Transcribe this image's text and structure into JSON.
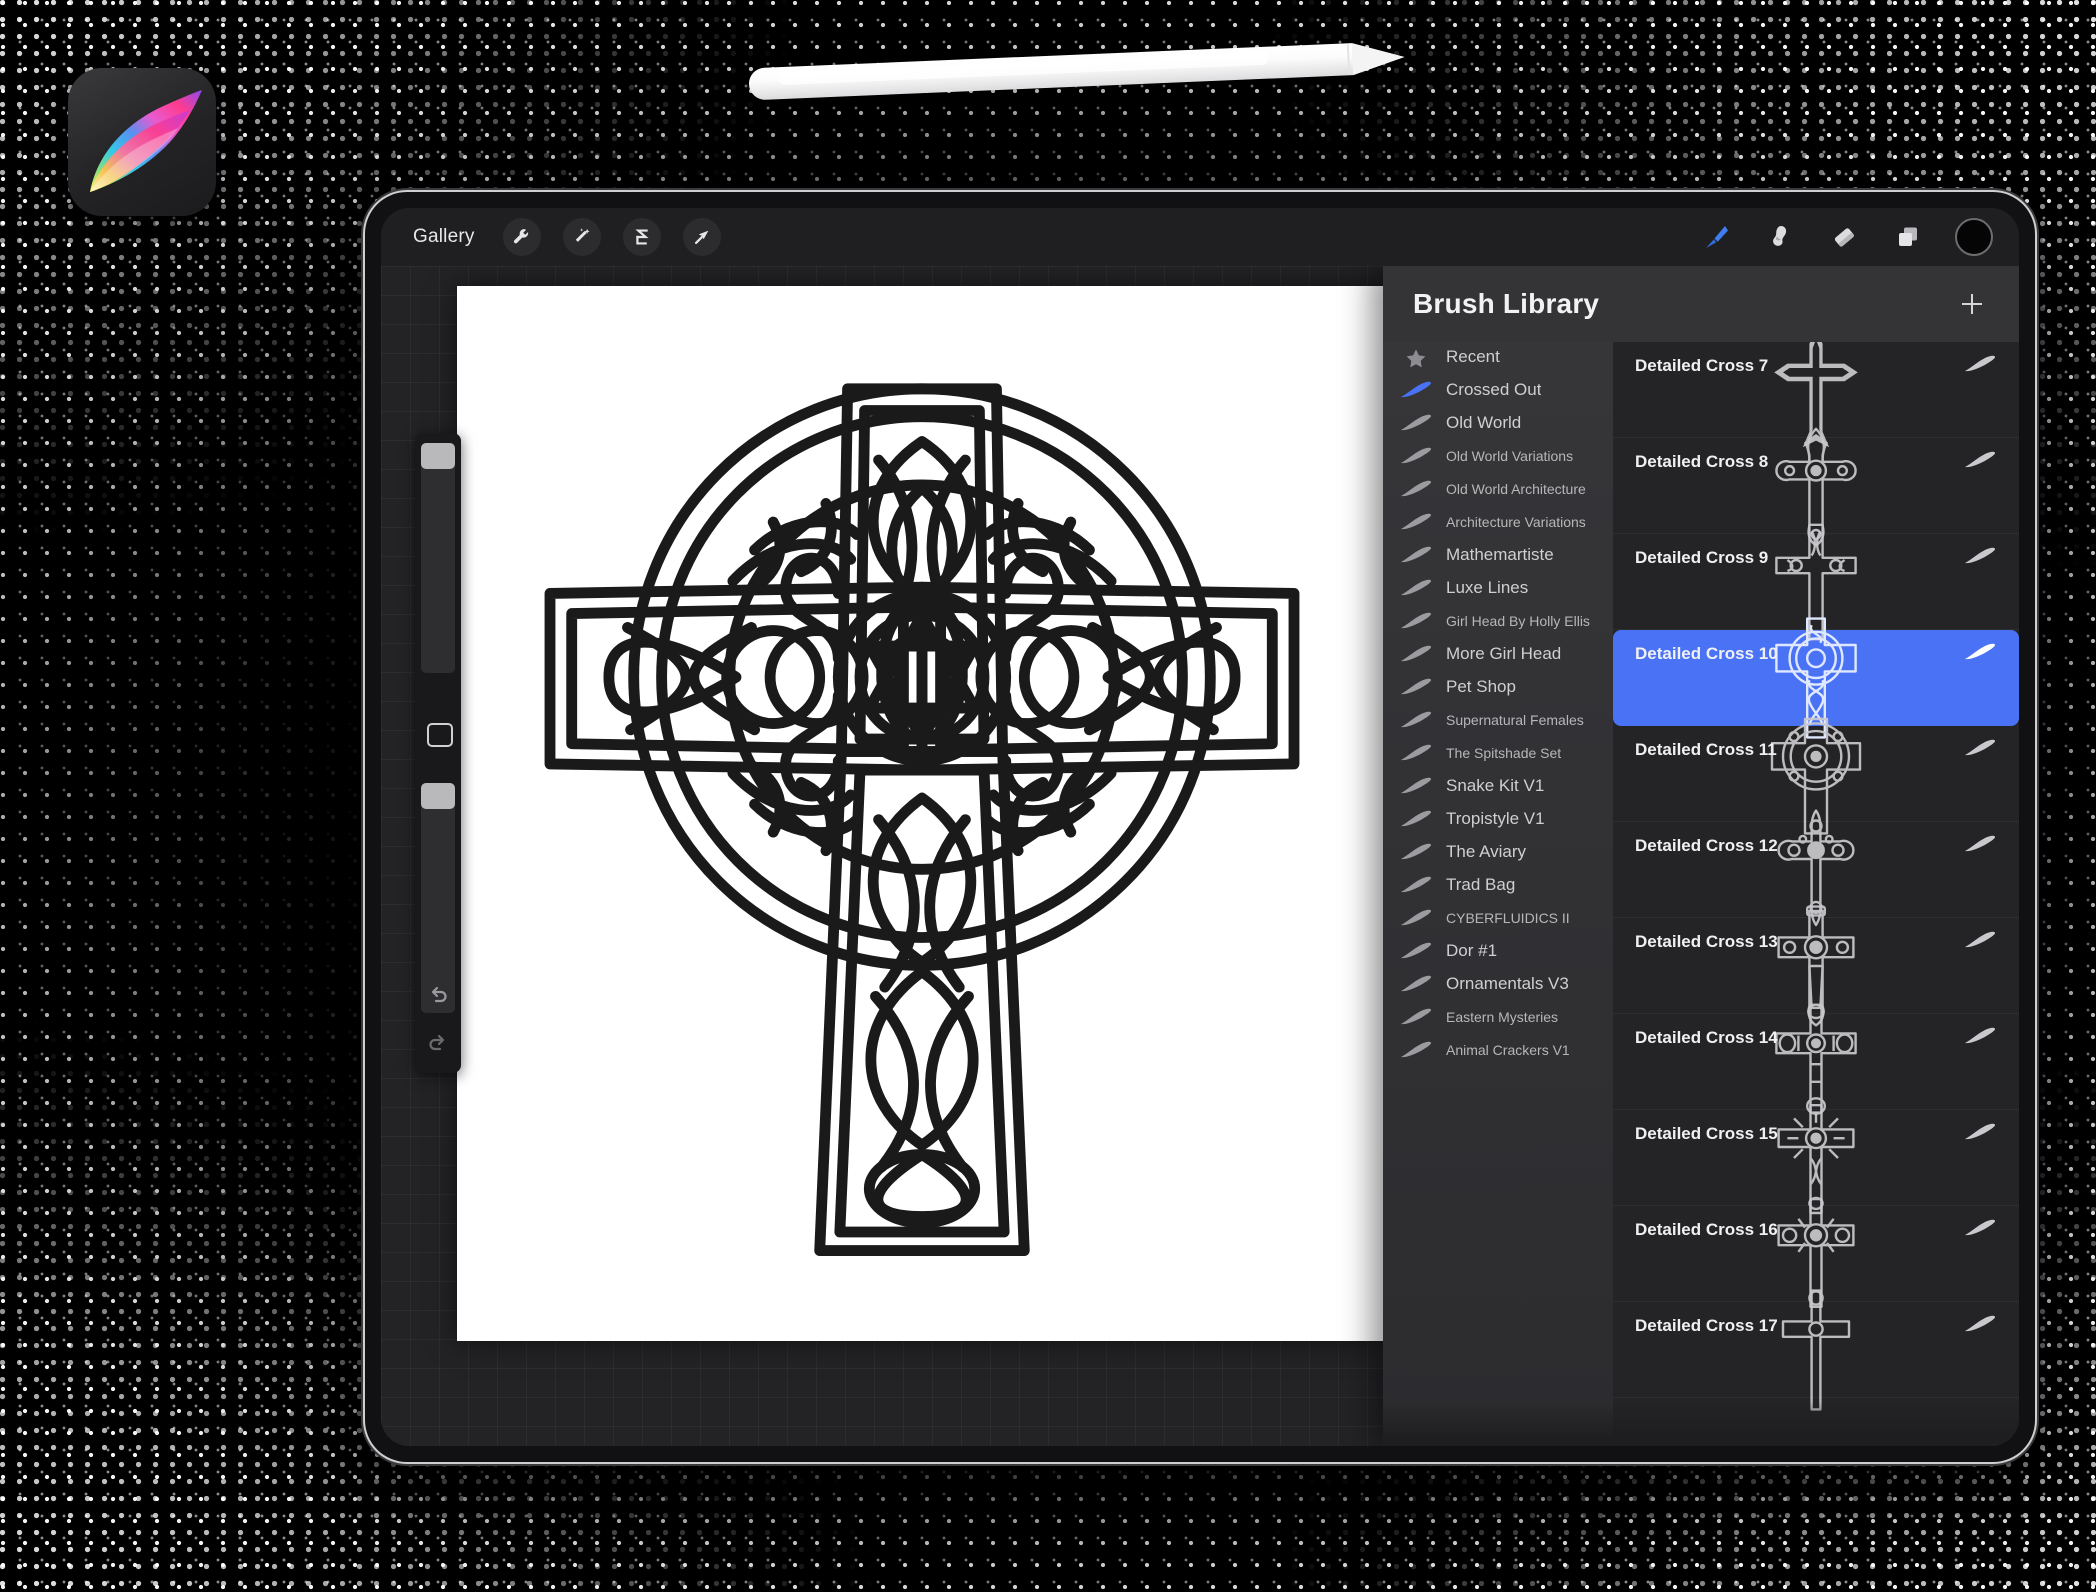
{
  "app": {
    "name": "Procreate",
    "icon_name": "procreate-logo"
  },
  "device": {
    "name": "iPad Pro",
    "stylus": "Apple Pencil"
  },
  "toolbar": {
    "gallery_label": "Gallery",
    "left_icons": [
      {
        "name": "actions-wrench-icon",
        "glyph": "wrench"
      },
      {
        "name": "adjustments-wand-icon",
        "glyph": "wand"
      },
      {
        "name": "selection-icon",
        "glyph": "s-curve"
      },
      {
        "name": "transform-arrow-icon",
        "glyph": "arrow"
      }
    ],
    "right_icons": [
      {
        "name": "brush-tool-icon",
        "glyph": "brush",
        "active": true
      },
      {
        "name": "smudge-tool-icon",
        "glyph": "smudge",
        "active": false
      },
      {
        "name": "eraser-tool-icon",
        "glyph": "eraser",
        "active": false
      },
      {
        "name": "layers-icon",
        "glyph": "layers",
        "active": false
      }
    ],
    "color_swatch": "#050505"
  },
  "sidebar_controls": {
    "brush_size_label": "Brush size",
    "brush_opacity_label": "Brush opacity",
    "modify_label": "Modify",
    "undo_label": "Undo",
    "redo_label": "Redo"
  },
  "canvas": {
    "artwork_name": "celtic-cross-knotwork",
    "background": "#ffffff"
  },
  "brush_library": {
    "title": "Brush Library",
    "add_label": "+",
    "accent_color": "#4a72f5",
    "panel_color": "#2d2d30",
    "categories": [
      {
        "label": "Recent",
        "icon": "star-icon",
        "size": "normal",
        "selected": false
      },
      {
        "label": "Crossed Out",
        "icon": "brush-stroke-icon",
        "size": "normal",
        "selected": true
      },
      {
        "label": "Old World",
        "icon": "brush-stroke-icon",
        "size": "normal",
        "selected": false
      },
      {
        "label": "Old World Variations",
        "icon": "brush-stroke-icon",
        "size": "small",
        "selected": false
      },
      {
        "label": "Old World Architecture",
        "icon": "brush-stroke-icon",
        "size": "small",
        "selected": false
      },
      {
        "label": "Architecture Variations",
        "icon": "brush-stroke-icon",
        "size": "small",
        "selected": false
      },
      {
        "label": "Mathemartiste",
        "icon": "brush-stroke-icon",
        "size": "normal",
        "selected": false
      },
      {
        "label": "Luxe Lines",
        "icon": "brush-stroke-icon",
        "size": "normal",
        "selected": false
      },
      {
        "label": "Girl Head By Holly Ellis",
        "icon": "brush-stroke-icon",
        "size": "small",
        "selected": false
      },
      {
        "label": "More Girl Head",
        "icon": "brush-stroke-icon",
        "size": "normal",
        "selected": false
      },
      {
        "label": "Pet Shop",
        "icon": "brush-stroke-icon",
        "size": "normal",
        "selected": false
      },
      {
        "label": "Supernatural Females",
        "icon": "brush-stroke-icon",
        "size": "small",
        "selected": false
      },
      {
        "label": "The Spitshade Set",
        "icon": "brush-stroke-icon",
        "size": "small",
        "selected": false
      },
      {
        "label": "Snake Kit V1",
        "icon": "brush-stroke-icon",
        "size": "normal",
        "selected": false
      },
      {
        "label": "Tropistyle V1",
        "icon": "brush-stroke-icon",
        "size": "normal",
        "selected": false
      },
      {
        "label": "The Aviary",
        "icon": "brush-stroke-icon",
        "size": "normal",
        "selected": false
      },
      {
        "label": "Trad Bag",
        "icon": "brush-stroke-icon",
        "size": "normal",
        "selected": false
      },
      {
        "label": "CYBERFLUIDICS II",
        "icon": "brush-stroke-icon",
        "size": "small",
        "selected": false
      },
      {
        "label": "Dor #1",
        "icon": "brush-stroke-icon",
        "size": "normal",
        "selected": false
      },
      {
        "label": "Ornamentals V3",
        "icon": "brush-stroke-icon",
        "size": "normal",
        "selected": false
      },
      {
        "label": "Eastern Mysteries",
        "icon": "brush-stroke-icon",
        "size": "small",
        "selected": false
      },
      {
        "label": "Animal Crackers V1",
        "icon": "brush-stroke-icon",
        "size": "small",
        "selected": false
      }
    ],
    "brushes": [
      {
        "label": "Detailed Cross 7",
        "thumb": "cross-plain-fleury",
        "selected": false
      },
      {
        "label": "Detailed Cross 8",
        "thumb": "cross-ornate-round",
        "selected": false
      },
      {
        "label": "Detailed Cross 9",
        "thumb": "cross-knot-arms",
        "selected": false
      },
      {
        "label": "Detailed Cross 10",
        "thumb": "cross-celtic-knot",
        "selected": true
      },
      {
        "label": "Detailed Cross 11",
        "thumb": "cross-celtic-ring",
        "selected": false
      },
      {
        "label": "Detailed Cross 12",
        "thumb": "cross-budded-jewel",
        "selected": false
      },
      {
        "label": "Detailed Cross 13",
        "thumb": "cross-gem-center",
        "selected": false
      },
      {
        "label": "Detailed Cross 14",
        "thumb": "cross-banded-arms",
        "selected": false
      },
      {
        "label": "Detailed Cross 15",
        "thumb": "cross-radiant-rays",
        "selected": false
      },
      {
        "label": "Detailed Cross 16",
        "thumb": "cross-sunburst",
        "selected": false
      },
      {
        "label": "Detailed Cross 17",
        "thumb": "cross-tall-slim",
        "selected": false
      }
    ]
  }
}
